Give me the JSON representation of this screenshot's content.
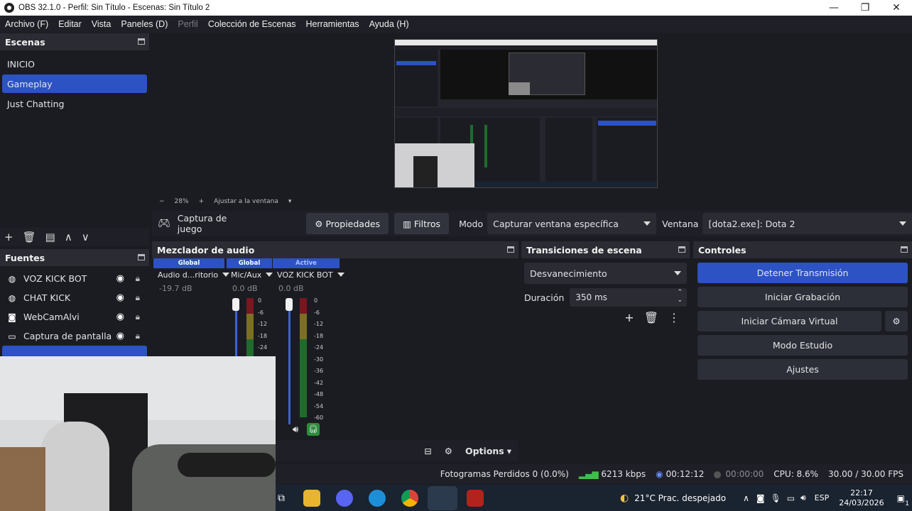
{
  "window": {
    "title": "OBS 32.1.0 - Perfil: Sin Título - Escenas: Sin Título 2",
    "minimize": "—",
    "maximize": "❐",
    "close": "✕"
  },
  "menu": [
    "Archivo (F)",
    "Editar",
    "Vista",
    "Paneles (D)",
    "Perfil",
    "Colección de Escenas",
    "Herramientas",
    "Ayuda (H)"
  ],
  "scenes": {
    "title": "Escenas",
    "items": [
      {
        "label": "INICIO",
        "selected": false
      },
      {
        "label": "Gameplay",
        "selected": true
      },
      {
        "label": "Just Chatting",
        "selected": false
      }
    ],
    "toolbar": [
      "+",
      "🗑",
      "▤",
      "∧",
      "∨"
    ]
  },
  "sources": {
    "title": "Fuentes",
    "items": [
      {
        "label": "VOZ KICK BOT",
        "icon": "browser-icon"
      },
      {
        "label": "CHAT KICK",
        "icon": "browser-icon"
      },
      {
        "label": "WebCamAlvi",
        "icon": "camera-icon"
      },
      {
        "label": "Captura de pantalla",
        "icon": "monitor-icon"
      }
    ]
  },
  "preview": {
    "zoom": "28%",
    "fit_label": "Ajustar a la ventana",
    "minus": "−",
    "plus": "+"
  },
  "source_toolbar": {
    "source_name": "Captura de juego",
    "properties_label": "Propiedades",
    "filters_label": "Filtros",
    "mode_label": "Modo",
    "mode_value": "Capturar ventana específica",
    "window_label": "Ventana",
    "window_value": "[dota2.exe]: Dota 2"
  },
  "mixer": {
    "title": "Mezclador de audio",
    "channels": [
      {
        "tag": "Global",
        "name": "Audio d...ritorio",
        "db": "-19.7 dB",
        "level": 0.0
      },
      {
        "tag": "Global",
        "name": "Mic/Aux",
        "db": "0.0 dB",
        "level": 1.0
      },
      {
        "tag": "Active",
        "name": "VOZ KICK BOT",
        "db": "0.0 dB",
        "level": 1.0
      }
    ],
    "scale": [
      "0",
      "-6",
      "-12",
      "-18",
      "-24",
      "-30",
      "-36",
      "-42",
      "-48",
      "-54",
      "-60"
    ],
    "options_label": "Options"
  },
  "transitions": {
    "title": "Transiciones de escena",
    "selected": "Desvanecimiento",
    "duration_label": "Duración",
    "duration_value": "350 ms"
  },
  "controls": {
    "title": "Controles",
    "buttons": [
      "Detener Transmisión",
      "Iniciar Grabación",
      "Iniciar Cámara Virtual",
      "Modo Estudio",
      "Ajustes"
    ]
  },
  "status": {
    "dropped": "Fotogramas Perdidos 0 (0.0%)",
    "bitrate": "6213 kbps",
    "stream_time": "00:12:12",
    "record_time": "00:00:00",
    "cpu": "CPU: 8.6%",
    "fps": "30.00 / 30.00 FPS"
  },
  "taskbar": {
    "weather": "21°C  Prac. despejado",
    "lang": "ESP",
    "time": "22:17",
    "date": "24/03/2026",
    "notification_count": "1"
  },
  "colors": {
    "accent": "#2c52c4",
    "bg": "#1b1c22",
    "panel": "#1f2027"
  }
}
